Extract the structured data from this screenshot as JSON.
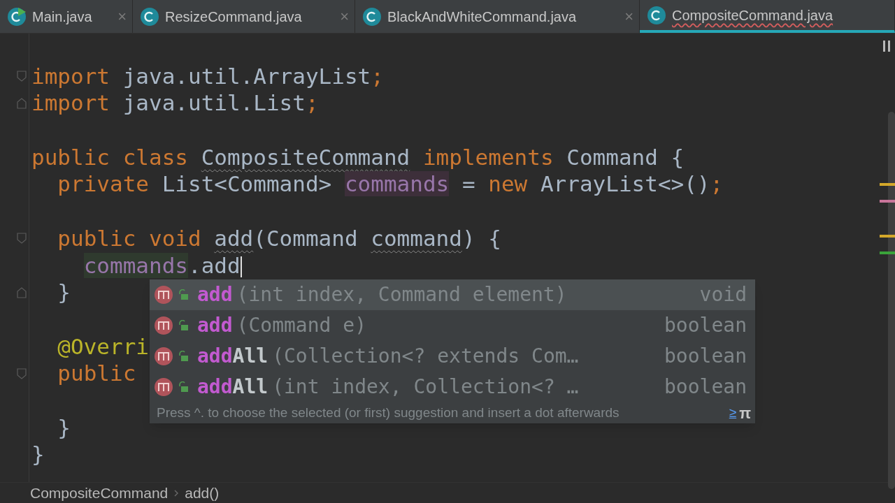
{
  "tabs": [
    {
      "label": "Main.java",
      "selected": false,
      "runnable": true,
      "error": false,
      "close": "×"
    },
    {
      "label": "ResizeCommand.java",
      "selected": false,
      "runnable": false,
      "error": false,
      "close": "×"
    },
    {
      "label": "BlackAndWhiteCommand.java",
      "selected": false,
      "runnable": false,
      "error": false,
      "close": "×"
    },
    {
      "label": "CompositeCommand.java",
      "selected": true,
      "runnable": false,
      "error": true
    }
  ],
  "editor": {
    "lines": [
      {
        "kind": "blank"
      },
      {
        "kind": "code",
        "tokens": [
          {
            "text": "import",
            "kind": "keyword"
          },
          {
            "text": " java.util.ArrayList",
            "kind": "plain"
          },
          {
            "text": ";",
            "kind": "keyword"
          }
        ],
        "fold_start": true
      },
      {
        "kind": "code",
        "tokens": [
          {
            "text": "import",
            "kind": "keyword"
          },
          {
            "text": " java.util.List",
            "kind": "plain"
          },
          {
            "text": ";",
            "kind": "keyword"
          }
        ],
        "fold_end": true
      },
      {
        "kind": "blank"
      },
      {
        "kind": "code",
        "tokens": [
          {
            "text": "public class ",
            "kind": "keyword"
          },
          {
            "text": "CompositeCommand",
            "kind": "plain",
            "squiggle": true
          },
          {
            "text": " implements ",
            "kind": "keyword"
          },
          {
            "text": "Command {",
            "kind": "plain"
          }
        ]
      },
      {
        "kind": "code",
        "tokens": [
          {
            "text": "  private ",
            "kind": "keyword"
          },
          {
            "text": "List<Command> ",
            "kind": "plain"
          },
          {
            "text": "commands",
            "kind": "field",
            "highlighted": true,
            "write_access": false
          },
          {
            "text": " = ",
            "kind": "plain"
          },
          {
            "text": "new ",
            "kind": "keyword"
          },
          {
            "text": "ArrayList<>()",
            "kind": "plain"
          },
          {
            "text": ";",
            "kind": "keyword"
          }
        ]
      },
      {
        "kind": "blank"
      },
      {
        "kind": "code",
        "tokens": [
          {
            "text": "  public void ",
            "kind": "keyword"
          },
          {
            "text": "add",
            "kind": "plain",
            "squiggle": true
          },
          {
            "text": "(Command ",
            "kind": "plain"
          },
          {
            "text": "command",
            "kind": "plain",
            "squiggle": true
          },
          {
            "text": ") {",
            "kind": "plain"
          }
        ],
        "fold_start": true
      },
      {
        "kind": "code",
        "tokens": [
          {
            "text": "    commands",
            "kind": "field",
            "highlighted": true,
            "write_access": true
          },
          {
            "text": ".add",
            "kind": "plain"
          }
        ],
        "caret": true
      },
      {
        "kind": "code",
        "tokens": [
          {
            "text": "  }",
            "kind": "plain"
          }
        ],
        "fold_end": true
      },
      {
        "kind": "blank"
      },
      {
        "kind": "code",
        "tokens": [
          {
            "text": "  @Overri",
            "kind": "annotation"
          }
        ]
      },
      {
        "kind": "code",
        "tokens": [
          {
            "text": "  public",
            "kind": "keyword"
          }
        ],
        "fold_start": true
      },
      {
        "kind": "blank"
      },
      {
        "kind": "code",
        "tokens": [
          {
            "text": "  }",
            "kind": "plain"
          }
        ]
      },
      {
        "kind": "code",
        "tokens": [
          {
            "text": "}",
            "kind": "plain"
          }
        ]
      }
    ]
  },
  "completion": {
    "items": [
      {
        "match": "add",
        "params": "(int index, Command element)",
        "type": "void",
        "selected": true
      },
      {
        "match": "add",
        "params": "(Command e)",
        "type": "boolean",
        "selected": false
      },
      {
        "match": "add",
        "rest": "All",
        "params": "(Collection<? extends Com…",
        "type": "boolean",
        "selected": false
      },
      {
        "match": "add",
        "rest": "All",
        "params": "(int index, Collection<? …",
        "type": "boolean",
        "selected": false
      }
    ],
    "hint": "Press ^. to choose the selected (or first) suggestion and insert a dot afterwards",
    "hint_link": "≥",
    "hint_symbol": "π"
  },
  "scroll_markers": [
    {
      "color": "#d4a82a"
    },
    {
      "color": "#c9759a"
    },
    {
      "color": "#d4a82a"
    },
    {
      "color": "#3aa33a"
    }
  ],
  "breadcrumbs": [
    "CompositeCommand",
    "add()"
  ]
}
